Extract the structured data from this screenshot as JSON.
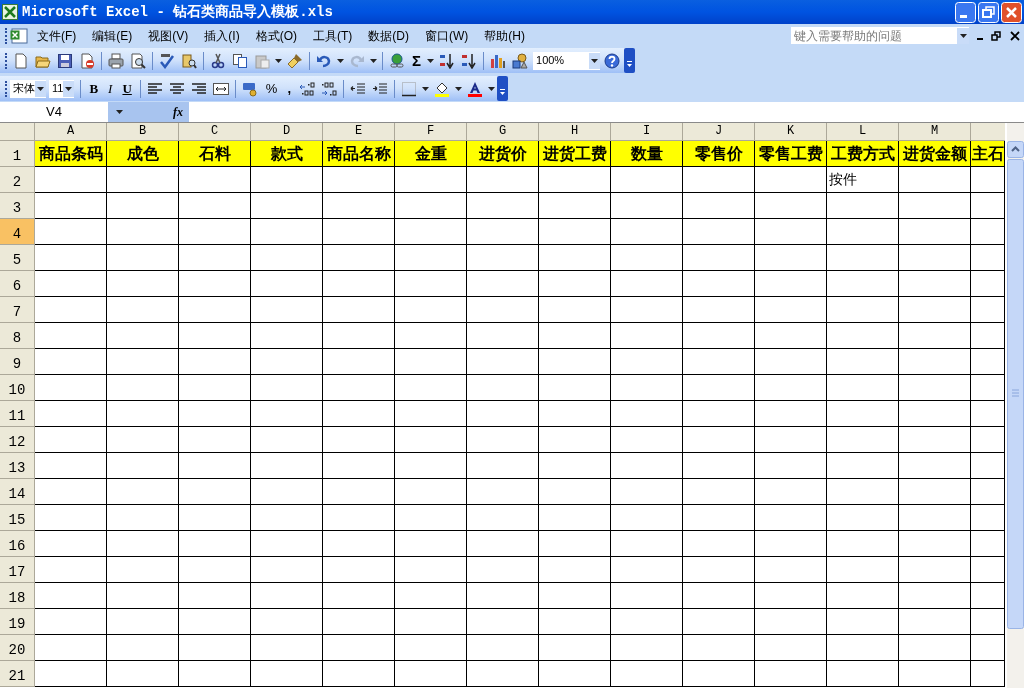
{
  "window": {
    "title": "Microsoft Excel - 钻石类商品导入模板.xls"
  },
  "menu": [
    {
      "label": "文件(F)"
    },
    {
      "label": "编辑(E)"
    },
    {
      "label": "视图(V)"
    },
    {
      "label": "插入(I)"
    },
    {
      "label": "格式(O)"
    },
    {
      "label": "工具(T)"
    },
    {
      "label": "数据(D)"
    },
    {
      "label": "窗口(W)"
    },
    {
      "label": "帮助(H)"
    }
  ],
  "help_box": {
    "placeholder": "键入需要帮助的问题"
  },
  "standard_toolbar": {
    "autosum": "Σ",
    "zoom": "100%"
  },
  "formatting_toolbar": {
    "font": "宋体",
    "size": "11",
    "style_buttons": [
      "B",
      "I",
      "U"
    ],
    "percent": "%",
    "comma": ","
  },
  "formula_bar": {
    "name_box": "V4",
    "fx": "fx"
  },
  "sheet": {
    "columns": [
      "A",
      "B",
      "C",
      "D",
      "E",
      "F",
      "G",
      "H",
      "I",
      "J",
      "K",
      "L",
      "M"
    ],
    "rows": [
      {
        "number": "1",
        "selected": false,
        "kind": "heading",
        "cells": [
          "商品条码",
          "成色",
          "石料",
          "款式",
          "商品名称",
          "金重",
          "进货价",
          "进货工费",
          "数量",
          "零售价",
          "零售工费",
          "工费方式",
          "进货金额",
          "主石"
        ]
      },
      {
        "number": "2",
        "selected": false,
        "kind": "data",
        "cells": [
          "",
          "",
          "",
          "",
          "",
          "",
          "",
          "",
          "",
          "",
          "",
          "按件",
          "",
          ""
        ]
      },
      {
        "number": "3",
        "selected": false
      },
      {
        "number": "4",
        "selected": true
      },
      {
        "number": "5",
        "selected": false
      },
      {
        "number": "6",
        "selected": false
      },
      {
        "number": "7",
        "selected": false
      },
      {
        "number": "8",
        "selected": false
      },
      {
        "number": "9",
        "selected": false
      },
      {
        "number": "10",
        "selected": false
      },
      {
        "number": "11",
        "selected": false
      },
      {
        "number": "12",
        "selected": false
      },
      {
        "number": "13",
        "selected": false
      },
      {
        "number": "14",
        "selected": false
      },
      {
        "number": "15",
        "selected": false
      },
      {
        "number": "16",
        "selected": false
      },
      {
        "number": "17",
        "selected": false
      },
      {
        "number": "18",
        "selected": false
      },
      {
        "number": "19",
        "selected": false
      },
      {
        "number": "20",
        "selected": false
      },
      {
        "number": "21",
        "selected": false
      }
    ]
  }
}
